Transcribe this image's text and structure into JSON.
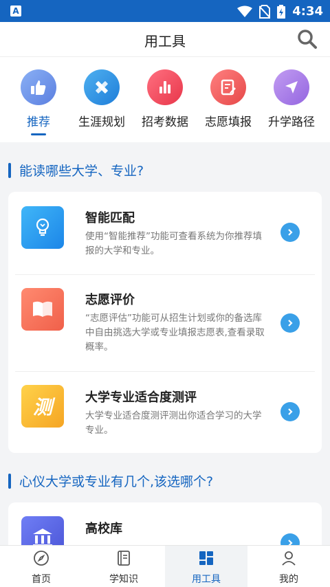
{
  "status_bar": {
    "app_badge": "A",
    "time": "4:34"
  },
  "header": {
    "title": "用工具"
  },
  "categories": [
    {
      "label": "推荐",
      "icon": "thumbs-up-icon",
      "color": "#6a8ee6",
      "active": true
    },
    {
      "label": "生涯规划",
      "icon": "ruler-pencil-icon",
      "color": "#2f8fe6"
    },
    {
      "label": "招考数据",
      "icon": "bar-chart-icon",
      "color": "#ee4a5a"
    },
    {
      "label": "志愿填报",
      "icon": "form-edit-icon",
      "color": "#ef5b5b"
    },
    {
      "label": "升学路径",
      "icon": "navigation-arrow-icon",
      "color": "#a87de6"
    }
  ],
  "section1": {
    "title": "能读哪些大学、专业?",
    "items": [
      {
        "name": "智能匹配",
        "icon": "lightbulb-icon",
        "desc": "使用“智能推荐”功能可查看系统为你推荐填报的大学和专业。"
      },
      {
        "name": "志愿评价",
        "icon": "open-book-icon",
        "desc": "“志愿评估”功能可从招生计划或你的备选库中自由挑选大学或专业填报志愿表,查看录取概率。"
      },
      {
        "name": "大学专业适合度测评",
        "icon": "test-glyph-icon",
        "glyph": "测",
        "desc": "大学专业适合度测评测出你适合学习的大学专业。"
      }
    ]
  },
  "section2": {
    "title": "心仪大学或专业有几个,该选哪个?",
    "items": [
      {
        "name": "高校库",
        "icon": "university-building-icon",
        "desc": ""
      }
    ]
  },
  "tabbar": [
    {
      "label": "首页",
      "icon": "compass-icon"
    },
    {
      "label": "学知识",
      "icon": "book-icon"
    },
    {
      "label": "用工具",
      "icon": "tools-grid-icon",
      "active": true
    },
    {
      "label": "我的",
      "icon": "person-icon"
    }
  ],
  "colors": {
    "primary": "#1565c0",
    "accent_blue": "#3aa0e8",
    "text_gray": "#777777"
  }
}
